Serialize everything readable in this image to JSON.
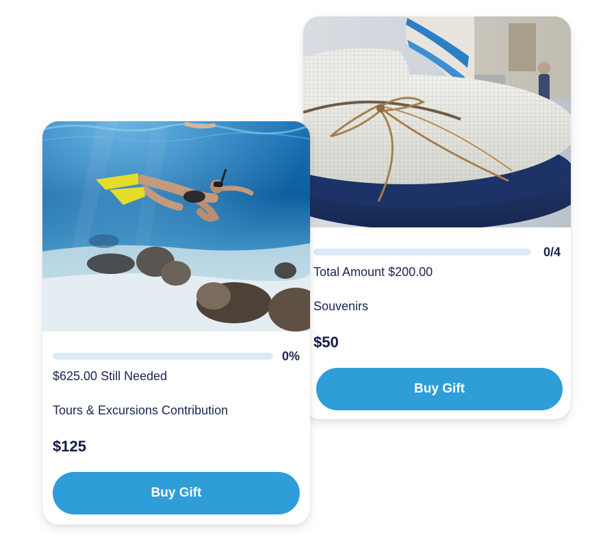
{
  "cards": [
    {
      "id": "tours",
      "image": "underwater-snorkeler-photo",
      "progress_percent": 0,
      "progress_label": "0%",
      "amount_text": "$625.00 Still Needed",
      "title": "Tours & Excursions Contribution",
      "price": "$125",
      "button_label": "Buy Gift"
    },
    {
      "id": "souvenirs",
      "image": "straw-sun-hats-photo",
      "progress_percent": 0,
      "progress_label": "0/4",
      "amount_text": "Total Amount $200.00",
      "title": "Souvenirs",
      "price": "$50",
      "button_label": "Buy Gift"
    }
  ],
  "colors": {
    "accent": "#2f9ed8",
    "progress_track": "#dbeaf6",
    "text": "#1a2450"
  }
}
